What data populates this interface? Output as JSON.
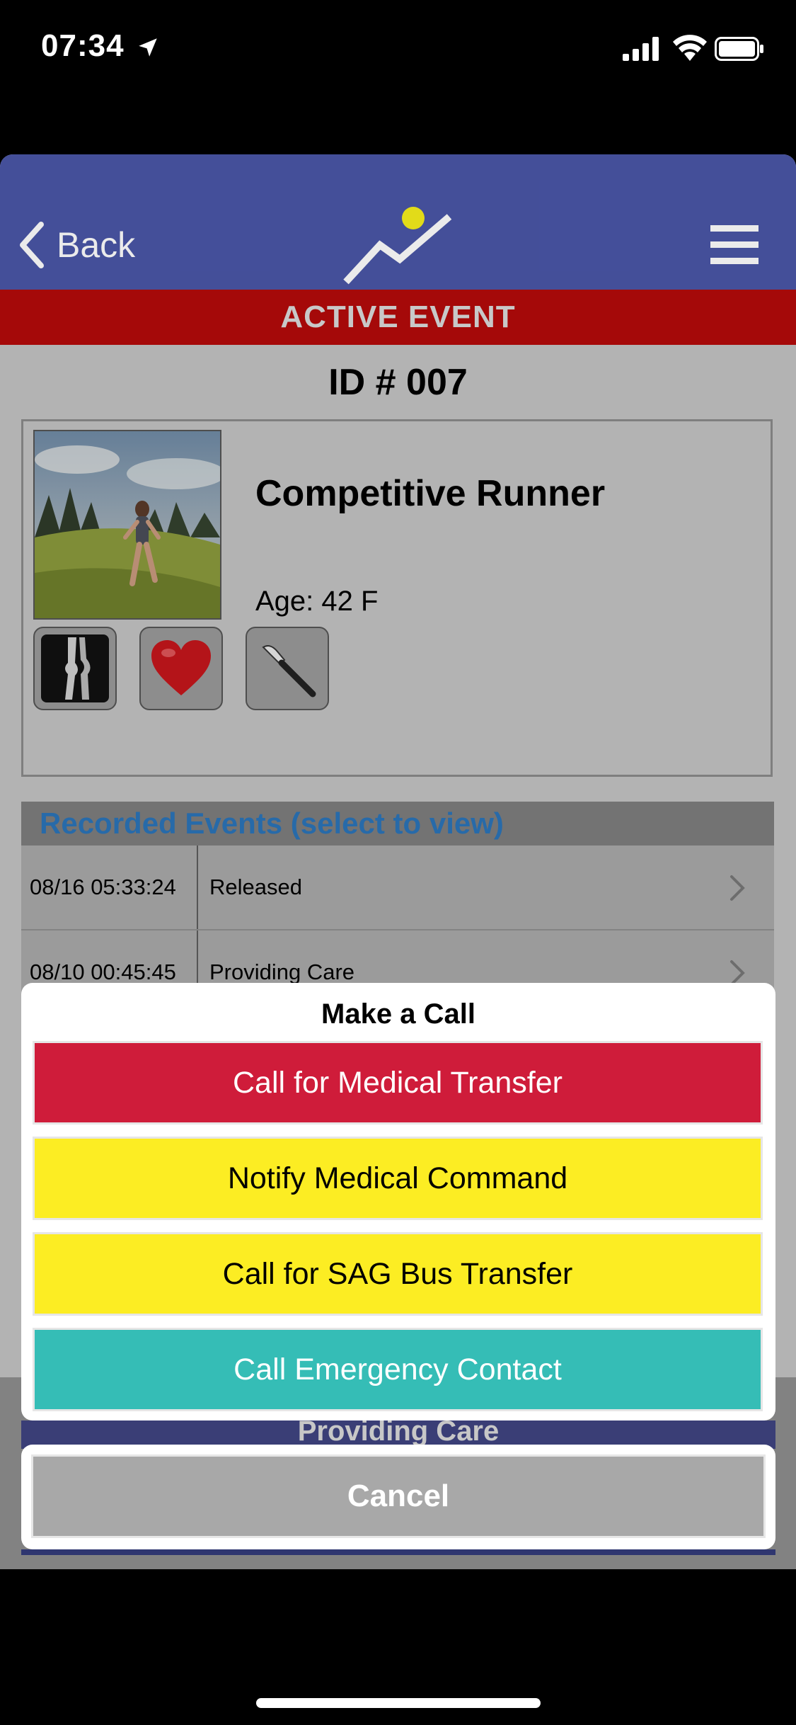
{
  "status_bar": {
    "time": "07:34",
    "icons": [
      "location-arrow-icon",
      "cellular-signal-icon",
      "wifi-icon",
      "battery-icon"
    ]
  },
  "navbar": {
    "back_label": "Back",
    "logo": "app-logo-icon",
    "menu": "hamburger-menu-icon",
    "background_color": "#4a56a7"
  },
  "banner": {
    "label": "ACTIVE EVENT",
    "color": "#b30a0a"
  },
  "event": {
    "id_label": "ID # 007"
  },
  "patient": {
    "name": "Competitive Runner",
    "age": "Age: 42 F",
    "photo": "runner-photo",
    "condition_icons": [
      "knee-xray-icon",
      "heart-icon",
      "scalpel-icon"
    ]
  },
  "recorded_events": {
    "header": "Recorded Events (select to view)",
    "rows": [
      {
        "time": "08/16 05:33:24",
        "status": "Released"
      },
      {
        "time": "08/10 00:45:45",
        "status": "Providing Care"
      }
    ]
  },
  "bottom_bar": {
    "status_label": "Providing Care"
  },
  "action_sheet": {
    "title": "Make a Call",
    "buttons": [
      {
        "label": "Call for Medical Transfer",
        "color": "#cf1c3a"
      },
      {
        "label": "Notify Medical Command",
        "color": "#fced23"
      },
      {
        "label": "Call for SAG Bus Transfer",
        "color": "#fced23"
      },
      {
        "label": "Call Emergency Contact",
        "color": "#35bdb6"
      }
    ],
    "cancel_label": "Cancel"
  }
}
